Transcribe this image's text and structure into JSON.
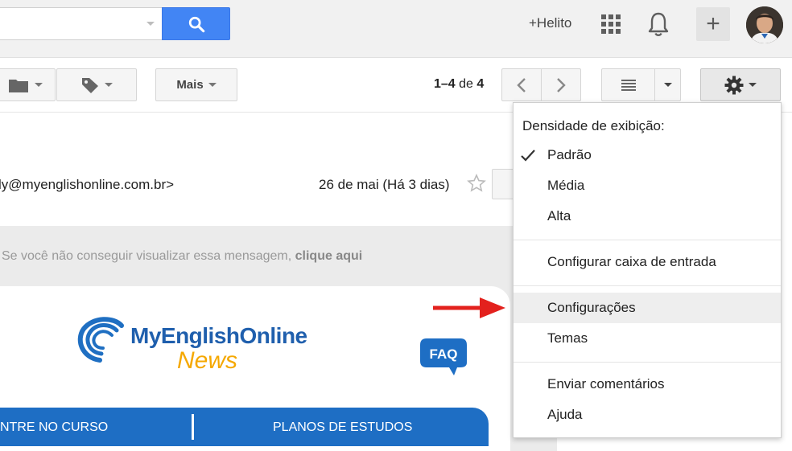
{
  "header": {
    "search_placeholder": "",
    "user_link": "+Helito"
  },
  "toolbar": {
    "more_label": "Mais",
    "pagination": {
      "range": "1–4",
      "of": "de",
      "total": "4"
    }
  },
  "email": {
    "sender_email": "ly@myenglishonline.com.br>",
    "date": "26 de mai (Há 3 dias)",
    "notice_text": "Se você não conseguir visualizar essa mensagem, ",
    "notice_link": "clique aqui",
    "logo_main": "MyEnglishOnline",
    "logo_sub": "News",
    "faq": "FAQ",
    "nav": [
      "NTRE NO CURSO",
      "PLANOS DE ESTUDOS"
    ]
  },
  "settings_menu": {
    "heading": "Densidade de exibição:",
    "density_options": [
      {
        "label": "Padrão",
        "checked": true
      },
      {
        "label": "Média",
        "checked": false
      },
      {
        "label": "Alta",
        "checked": false
      }
    ],
    "items": {
      "configure_inbox": "Configurar caixa de entrada",
      "settings": "Configurações",
      "themes": "Temas",
      "send_feedback": "Enviar comentários",
      "help": "Ajuda"
    },
    "highlighted_item": "settings"
  },
  "colors": {
    "search_blue": "#4285f4",
    "accent_blue": "#1e6ec4",
    "logo_yellow": "#f5a800",
    "arrow_red": "#e3211d",
    "menu_hover": "#eeeeee"
  },
  "icons": [
    "search-icon",
    "apps-grid-icon",
    "bell-icon",
    "plus-icon",
    "folder-icon",
    "label-icon",
    "chevron-left-icon",
    "chevron-right-icon",
    "list-density-icon",
    "gear-icon",
    "star-icon",
    "check-icon"
  ]
}
